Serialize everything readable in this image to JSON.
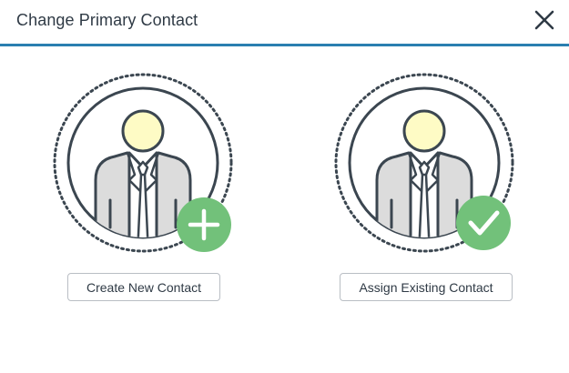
{
  "dialog": {
    "title": "Change Primary Contact",
    "close_icon": "close-icon",
    "accent_color": "#2a7fb0"
  },
  "options": [
    {
      "icon": "person-add-icon",
      "badge_icon": "plus-icon",
      "button_label": "Create New Contact"
    },
    {
      "icon": "person-check-icon",
      "badge_icon": "checkmark-icon",
      "button_label": "Assign Existing Contact"
    }
  ],
  "colors": {
    "badge_green": "#72c17a",
    "head_yellow": "#fefbc5",
    "outline": "#3b4650",
    "suit_gray": "#dcdcdc"
  }
}
